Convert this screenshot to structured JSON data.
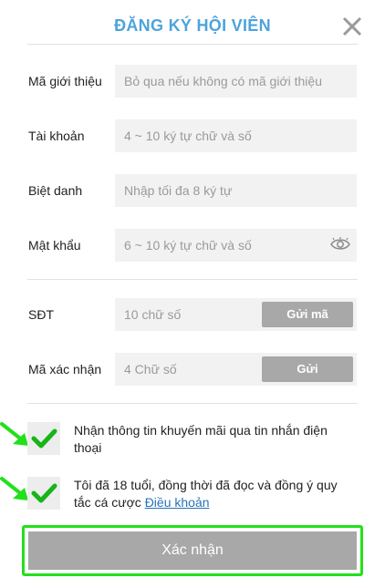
{
  "header": {
    "title": "ĐĂNG KÝ HỘI VIÊN",
    "close_icon": "close-icon"
  },
  "form": {
    "referral": {
      "label": "Mã giới thiệu",
      "placeholder": "Bỏ qua nếu không có mã giới thiệu",
      "value": ""
    },
    "account": {
      "label": "Tài khoản",
      "placeholder": "4 ~ 10 ký tự chữ và số",
      "value": ""
    },
    "nickname": {
      "label": "Biệt danh",
      "placeholder": "Nhập tối đa 8 ký tự",
      "value": ""
    },
    "password": {
      "label": "Mật khẩu",
      "placeholder": "6 ~ 10 ký tự chữ và số",
      "value": "",
      "toggle_icon": "eye-icon"
    },
    "phone": {
      "label": "SĐT",
      "placeholder": "10 chữ số",
      "value": "",
      "button_label": "Gửi mã"
    },
    "verify": {
      "label": "Mã xác nhận",
      "placeholder": "4 Chữ số",
      "value": "",
      "button_label": "Gửi"
    }
  },
  "agreements": [
    {
      "text": "Nhận thông tin khuyến mãi qua tin nhắn điện thoại",
      "checked": true
    },
    {
      "text": "Tôi đã 18 tuổi, đồng thời đã đọc và đồng ý quy tắc cá cược",
      "link_text": "Điều khoản",
      "checked": true
    }
  ],
  "submit": {
    "label": "Xác nhận"
  },
  "colors": {
    "title": "#4ea3dc",
    "check": "#18b418",
    "arrow": "#22e01a",
    "highlight_border": "#22e01a",
    "button": "#a8a8a8",
    "link": "#2a73b8"
  }
}
